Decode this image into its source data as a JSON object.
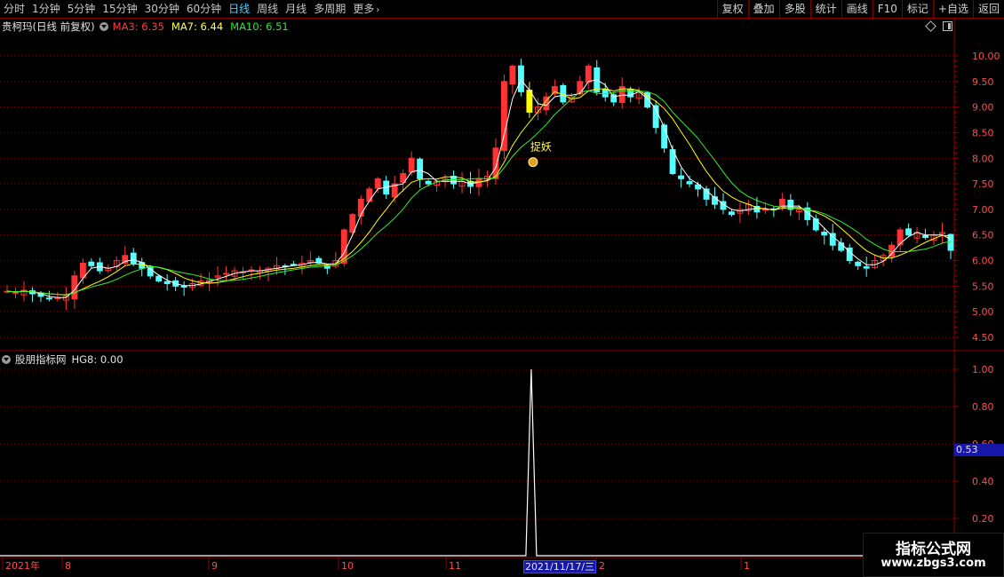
{
  "toolbar": {
    "timeframes": [
      "分时",
      "1分钟",
      "5分钟",
      "15分钟",
      "30分钟",
      "60分钟",
      "日线",
      "周线",
      "月线",
      "多周期",
      "更多"
    ],
    "active_timeframe": "日线",
    "right_buttons": [
      "复权",
      "叠加",
      "多股",
      "统计",
      "画线",
      "F10",
      "标记",
      "+自选",
      "返回"
    ]
  },
  "price_panel": {
    "title": "贵柯玛(日线 前复权)",
    "ma3_label": "MA3: 6.35",
    "ma7_label": "MA7: 6.44",
    "ma10_label": "MA10: 6.51",
    "y_ticks": [
      "10.00",
      "9.50",
      "9.00",
      "8.50",
      "8.00",
      "7.50",
      "7.00",
      "6.50",
      "6.00",
      "5.50",
      "5.00",
      "4.50"
    ],
    "signal_label": "捉妖",
    "signal_icon": "money-bag-icon"
  },
  "indicator_panel": {
    "name": "股朋指标网",
    "value_label": "HG8: 0.00",
    "y_ticks": [
      "1.00",
      "0.80",
      "0.60",
      "0.40",
      "0.20"
    ],
    "cursor_value": "0.53"
  },
  "x_axis": {
    "labels": [
      "2021年",
      "8",
      "9",
      "10",
      "11",
      "2021/11/17/三",
      "2",
      "1"
    ],
    "cursor_date": "2021/11/17/三"
  },
  "watermark": {
    "title": "指标公式网",
    "url": "www.zbgs3.com"
  },
  "colors": {
    "up": "#ff3333",
    "down": "#54ffff",
    "ma3": "#ffffff",
    "ma7": "#ffff00",
    "ma10": "#33ee33",
    "grid": "#8a0000",
    "signal": "#ffff00"
  },
  "chart_data": [
    {
      "type": "candlestick",
      "title": "贵柯玛(日线 前复权)",
      "ylim": [
        4.3,
        10.4
      ],
      "series_names": [
        "MA3",
        "MA7",
        "MA10"
      ],
      "close_path": [
        5.4,
        5.38,
        5.42,
        5.35,
        5.3,
        5.25,
        5.28,
        5.3,
        5.7,
        5.95,
        5.9,
        5.8,
        5.85,
        6.0,
        6.1,
        5.95,
        5.85,
        5.7,
        5.6,
        5.55,
        5.5,
        5.48,
        5.55,
        5.6,
        5.62,
        5.7,
        5.75,
        5.8,
        5.78,
        5.82,
        5.8,
        5.85,
        5.9,
        5.88,
        5.92,
        5.95,
        6.0,
        5.95,
        5.85,
        6.0,
        6.6,
        6.9,
        7.2,
        7.4,
        7.6,
        7.3,
        7.5,
        7.7,
        8.0,
        7.6,
        7.5,
        7.55,
        7.6,
        7.5,
        7.55,
        7.45,
        7.6,
        7.65,
        8.2,
        9.5,
        9.8,
        9.3,
        8.9,
        9.0,
        9.2,
        9.4,
        9.1,
        9.2,
        9.5,
        9.8,
        9.3,
        9.2,
        9.1,
        9.4,
        9.2,
        9.3,
        9.0,
        8.6,
        8.2,
        7.7,
        7.6,
        7.5,
        7.4,
        7.2,
        7.1,
        7.0,
        6.9,
        7.0,
        7.1,
        6.95,
        7.0,
        7.0,
        7.2,
        7.0,
        7.0,
        6.8,
        6.6,
        6.5,
        6.3,
        6.2,
        6.0,
        5.9,
        5.85,
        6.0,
        6.1,
        6.3,
        6.6,
        6.5,
        6.55,
        6.45,
        6.5,
        6.55,
        6.2
      ],
      "signal_date": "2021/11/17"
    },
    {
      "type": "line",
      "title": "股朋指标网",
      "series": [
        {
          "name": "HG8",
          "description": "spike to 1.00 on 2021/11/17, otherwise 0.00"
        }
      ],
      "ylim": [
        0,
        1.05
      ]
    }
  ]
}
